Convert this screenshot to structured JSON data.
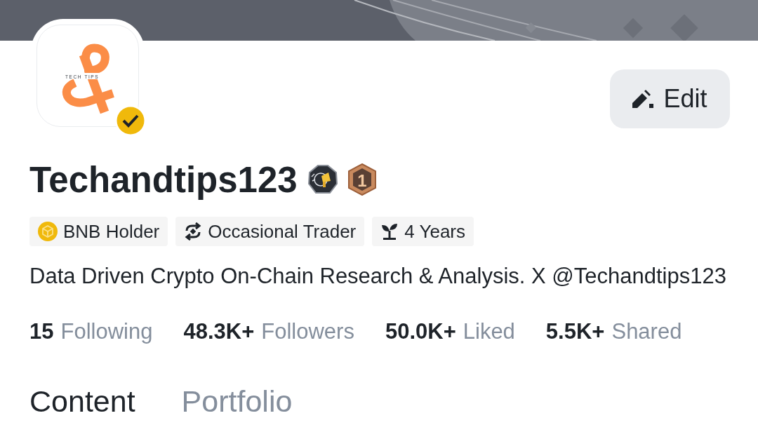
{
  "avatar": {
    "logo_text": "TECH TIPS",
    "verified": true
  },
  "edit_button": {
    "label": "Edit"
  },
  "profile": {
    "name": "Techandtips123",
    "badges": [
      {
        "kind": "megaphone"
      },
      {
        "kind": "rank",
        "label": "1"
      }
    ]
  },
  "tags": [
    {
      "kind": "bnb",
      "label": "BNB Holder"
    },
    {
      "kind": "trader",
      "label": "Occasional Trader"
    },
    {
      "kind": "years",
      "label": "4 Years"
    }
  ],
  "bio": "Data Driven Crypto On-Chain Research & Analysis. X @Techandtips123",
  "stats": [
    {
      "count": "15",
      "metric": "Following"
    },
    {
      "count": "48.3K+",
      "metric": "Followers"
    },
    {
      "count": "50.0K+",
      "metric": "Liked"
    },
    {
      "count": "5.5K+",
      "metric": "Shared"
    }
  ],
  "tabs": [
    {
      "label": "Content",
      "selected": true
    },
    {
      "label": "Portfolio",
      "selected": false
    }
  ]
}
